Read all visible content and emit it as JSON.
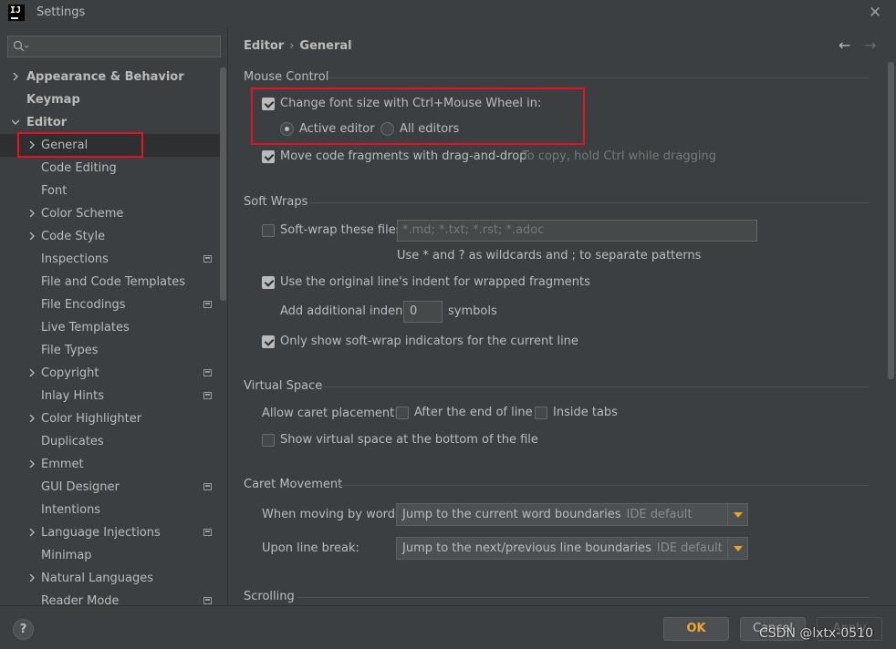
{
  "window": {
    "title": "Settings",
    "app_icon_text": "IJ"
  },
  "search": {
    "placeholder": ""
  },
  "sidebar": {
    "items": [
      {
        "label": "Appearance & Behavior"
      },
      {
        "label": "Keymap"
      },
      {
        "label": "Editor"
      },
      {
        "label": "General"
      },
      {
        "label": "Code Editing"
      },
      {
        "label": "Font"
      },
      {
        "label": "Color Scheme"
      },
      {
        "label": "Code Style"
      },
      {
        "label": "Inspections"
      },
      {
        "label": "File and Code Templates"
      },
      {
        "label": "File Encodings"
      },
      {
        "label": "Live Templates"
      },
      {
        "label": "File Types"
      },
      {
        "label": "Copyright"
      },
      {
        "label": "Inlay Hints"
      },
      {
        "label": "Color Highlighter"
      },
      {
        "label": "Duplicates"
      },
      {
        "label": "Emmet"
      },
      {
        "label": "GUI Designer"
      },
      {
        "label": "Intentions"
      },
      {
        "label": "Language Injections"
      },
      {
        "label": "Minimap"
      },
      {
        "label": "Natural Languages"
      },
      {
        "label": "Reader Mode"
      }
    ]
  },
  "breadcrumb": {
    "parent": "Editor",
    "separator": "›",
    "current": "General"
  },
  "nav": {
    "back_icon": "←",
    "forward_icon": "→"
  },
  "mouse_control": {
    "title": "Mouse Control",
    "change_font": {
      "label": "Change font size with Ctrl+Mouse Wheel in:",
      "checked": true
    },
    "active_editor": {
      "label": "Active editor",
      "selected": true
    },
    "all_editors": {
      "label": "All editors",
      "selected": false
    },
    "move_code": {
      "label": "Move code fragments with drag-and-drop",
      "checked": true,
      "hint": "To copy, hold Ctrl while dragging"
    }
  },
  "soft_wraps": {
    "title": "Soft Wraps",
    "soft_wrap_files": {
      "label": "Soft-wrap these files:",
      "checked": false,
      "placeholder": "*.md; *.txt; *.rst; *.adoc"
    },
    "wildcard_hint": "Use * and ? as wildcards and ; to separate patterns",
    "original_indent": {
      "label": "Use the original line's indent for wrapped fragments",
      "checked": true
    },
    "additional_indent": {
      "label": "Add additional indent:",
      "value": "0",
      "unit": "symbols"
    },
    "only_current_line": {
      "label": "Only show soft-wrap indicators for the current line",
      "checked": true
    }
  },
  "virtual_space": {
    "title": "Virtual Space",
    "allow_caret_label": "Allow caret placement:",
    "after_end": {
      "label": "After the end of line",
      "checked": false
    },
    "inside_tabs": {
      "label": "Inside tabs",
      "checked": false
    },
    "show_virtual": {
      "label": "Show virtual space at the bottom of the file",
      "checked": false
    }
  },
  "caret_movement": {
    "title": "Caret Movement",
    "moving_by_words": {
      "label": "When moving by words:",
      "value": "Jump to the current word boundaries",
      "default_tag": "IDE default"
    },
    "upon_line_break": {
      "label": "Upon line break:",
      "value": "Jump to the next/previous line boundaries",
      "default_tag": "IDE default"
    }
  },
  "scrolling": {
    "title": "Scrolling"
  },
  "footer": {
    "help": "?",
    "ok": "OK",
    "cancel": "Cancel",
    "apply": "Apply",
    "watermark": "CSDN @lxtx-0510"
  },
  "colors": {
    "background": "#3c3f41",
    "highlight_box": "#e81123",
    "ok_text": "#f0a732",
    "combo_arrow": "#e6a32b"
  },
  "icons": {
    "sidebar_chevron": "chevron-right-icon",
    "sidebar_expanded": "chevron-down-icon",
    "project_settings": "project-scope-icon",
    "search": "search-icon"
  }
}
